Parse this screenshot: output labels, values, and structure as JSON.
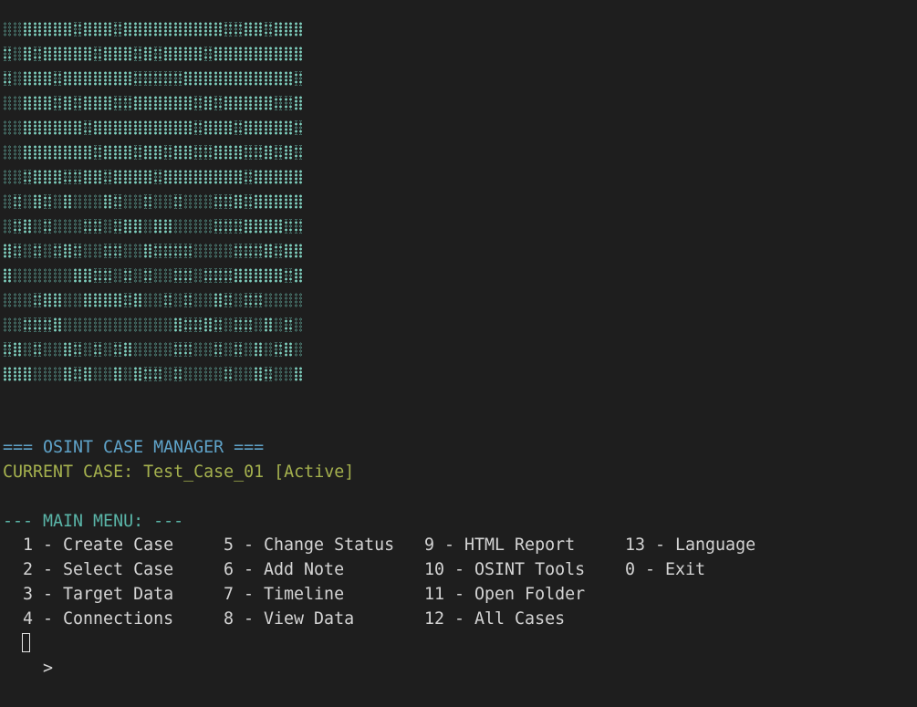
{
  "header": {
    "title": "=== OSINT CASE MANAGER ===",
    "current_case": "CURRENT CASE: Test_Case_01 [Active]"
  },
  "menu": {
    "heading": "--- MAIN MENU: ---",
    "items": [
      {
        "label": "1 - Create Case"
      },
      {
        "label": "2 - Select Case"
      },
      {
        "label": "3 - Target Data"
      },
      {
        "label": "4 - Connections"
      },
      {
        "label": "5 - Change Status"
      },
      {
        "label": "6 - Add Note"
      },
      {
        "label": "7 - Timeline"
      },
      {
        "label": "8 - View Data"
      },
      {
        "label": "9 - HTML Report"
      },
      {
        "label": "10 - OSINT Tools"
      },
      {
        "label": "11 - Open Folder"
      },
      {
        "label": "12 - All Cases"
      },
      {
        "label": "13 - Language"
      },
      {
        "label": "0 - Exit"
      }
    ]
  },
  "prompt": {
    "symbol": ">"
  },
  "banner": {
    "color": "#6fc3b3",
    "icon": "braille-ascii-art"
  }
}
